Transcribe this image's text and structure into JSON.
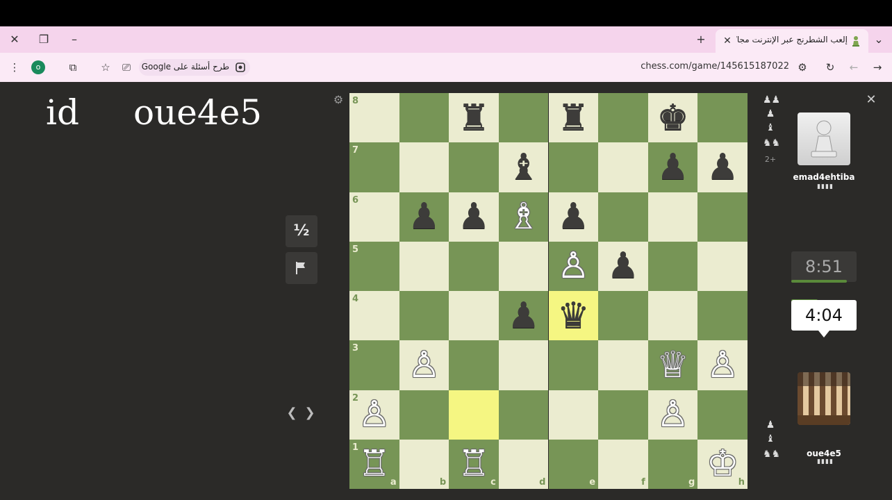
{
  "browser": {
    "tab_title": "إلعب الشطرنج عبر الإنترنت مجانًا -",
    "url": "chess.com/game/145615187022",
    "search_chip_text": "طرح أسئلة على Google",
    "profile_initial": "o"
  },
  "overlay": {
    "id_text": "id",
    "name_text": "oue4e5"
  },
  "game_controls": {
    "draw_label": "½"
  },
  "players": {
    "opponent": {
      "name": "emad4ehtiba",
      "clock": "8:51",
      "rating_bars": "▮▮▮▮",
      "clock_remaining_fraction": 0.95
    },
    "me": {
      "name": "oue4e5",
      "clock": "4:04",
      "rating_bars": "▮▮▮▮",
      "clock_remaining_fraction": 0.45
    }
  },
  "captured": {
    "by_opponent": [
      "♟♟",
      "♟",
      "♝",
      "♞♞"
    ],
    "by_opponent_plus": "2+",
    "by_me": [
      "♟",
      "♝",
      "♞♞"
    ]
  },
  "board": {
    "ranks": [
      "8",
      "7",
      "6",
      "5",
      "4",
      "3",
      "2",
      "1"
    ],
    "files": [
      "a",
      "b",
      "c",
      "d",
      "e",
      "f",
      "g",
      "h"
    ],
    "highlighted": [
      "c2",
      "e4"
    ],
    "pieces": [
      {
        "sq": "c8",
        "p": "♜",
        "c": "b"
      },
      {
        "sq": "e8",
        "p": "♜",
        "c": "b"
      },
      {
        "sq": "g8",
        "p": "♚",
        "c": "b"
      },
      {
        "sq": "d7",
        "p": "♝",
        "c": "b"
      },
      {
        "sq": "g7",
        "p": "♟",
        "c": "b"
      },
      {
        "sq": "h7",
        "p": "♟",
        "c": "b"
      },
      {
        "sq": "b6",
        "p": "♟",
        "c": "b"
      },
      {
        "sq": "c6",
        "p": "♟",
        "c": "b"
      },
      {
        "sq": "d6",
        "p": "♗",
        "c": "w"
      },
      {
        "sq": "e6",
        "p": "♟",
        "c": "b"
      },
      {
        "sq": "e5",
        "p": "♙",
        "c": "w"
      },
      {
        "sq": "f5",
        "p": "♟",
        "c": "b"
      },
      {
        "sq": "d4",
        "p": "♟",
        "c": "b"
      },
      {
        "sq": "e4",
        "p": "♛",
        "c": "b"
      },
      {
        "sq": "b3",
        "p": "♙",
        "c": "w"
      },
      {
        "sq": "g3",
        "p": "♕",
        "c": "w"
      },
      {
        "sq": "h3",
        "p": "♙",
        "c": "w"
      },
      {
        "sq": "a2",
        "p": "♙",
        "c": "w"
      },
      {
        "sq": "g2",
        "p": "♙",
        "c": "w"
      },
      {
        "sq": "a1",
        "p": "♖",
        "c": "w"
      },
      {
        "sq": "c1",
        "p": "♖",
        "c": "w"
      },
      {
        "sq": "h1",
        "p": "♔",
        "c": "w"
      }
    ]
  },
  "colors": {
    "light_square": "#ebecd0",
    "dark_square": "#779556",
    "highlight": "#f5f682"
  }
}
